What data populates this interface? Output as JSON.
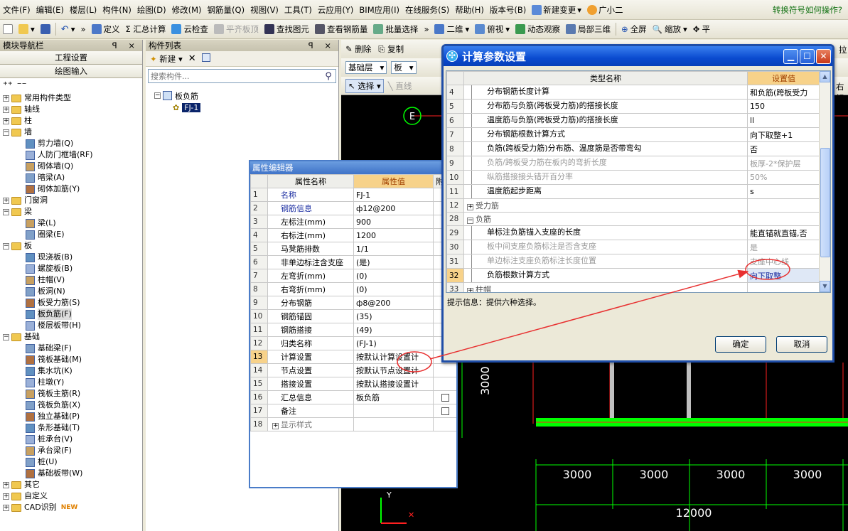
{
  "menubar": {
    "items": [
      "文件(F)",
      "编辑(E)",
      "楼层(L)",
      "构件(N)",
      "绘图(D)",
      "修改(M)",
      "钢筋量(Q)",
      "视图(V)",
      "工具(T)",
      "云应用(Y)",
      "BIM应用(I)",
      "在线服务(S)",
      "帮助(H)",
      "版本号(B)"
    ],
    "new_change": "新建变更",
    "guangxiaoer": "广小二",
    "help_link": "转换符号如何操作?"
  },
  "toolbar": {
    "define": "定义",
    "sum_calc": "Σ 汇总计算",
    "cloud_check": "云检查",
    "flush_slab": "平齐板顶",
    "find_element": "查找图元",
    "view_rebar": "查看钢筋量",
    "batch_select": "批量选择",
    "view_2d": "二维",
    "top_view": "俯视",
    "dynamic_view": "动态观察",
    "local_3d": "局部三维",
    "fullscreen": "全屏",
    "zoom": "缩放",
    "pan": "平"
  },
  "left_panel": {
    "title": "模块导航栏",
    "title_ctrl": "ꟼ ×",
    "project_settings": "工程设置",
    "drawing_input": "绘图输入",
    "tree": [
      {
        "label": "常用构件类型",
        "level": 0,
        "pm": "+"
      },
      {
        "label": "轴线",
        "level": 0,
        "pm": "+"
      },
      {
        "label": "柱",
        "level": 0,
        "pm": "+"
      },
      {
        "label": "墙",
        "level": 0,
        "pm": "−"
      },
      {
        "label": "剪力墙(Q)",
        "level": 1
      },
      {
        "label": "人防门框墙(RF)",
        "level": 1
      },
      {
        "label": "砌体墙(Q)",
        "level": 1
      },
      {
        "label": "暗梁(A)",
        "level": 1
      },
      {
        "label": "砌体加筋(Y)",
        "level": 1
      },
      {
        "label": "门窗洞",
        "level": 0,
        "pm": "+"
      },
      {
        "label": "梁",
        "level": 0,
        "pm": "−"
      },
      {
        "label": "梁(L)",
        "level": 1
      },
      {
        "label": "圈梁(E)",
        "level": 1
      },
      {
        "label": "板",
        "level": 0,
        "pm": "−"
      },
      {
        "label": "现浇板(B)",
        "level": 1
      },
      {
        "label": "螺旋板(B)",
        "level": 1
      },
      {
        "label": "柱帽(V)",
        "level": 1
      },
      {
        "label": "板洞(N)",
        "level": 1
      },
      {
        "label": "板受力筋(S)",
        "level": 1
      },
      {
        "label": "板负筋(F)",
        "level": 1,
        "selected": true
      },
      {
        "label": "楼层板带(H)",
        "level": 1
      },
      {
        "label": "基础",
        "level": 0,
        "pm": "−"
      },
      {
        "label": "基础梁(F)",
        "level": 1
      },
      {
        "label": "筏板基础(M)",
        "level": 1
      },
      {
        "label": "集水坑(K)",
        "level": 1
      },
      {
        "label": "柱墩(Y)",
        "level": 1
      },
      {
        "label": "筏板主筋(R)",
        "level": 1
      },
      {
        "label": "筏板负筋(X)",
        "level": 1
      },
      {
        "label": "独立基础(P)",
        "level": 1
      },
      {
        "label": "条形基础(T)",
        "level": 1
      },
      {
        "label": "桩承台(V)",
        "level": 1
      },
      {
        "label": "承台梁(F)",
        "level": 1
      },
      {
        "label": "桩(U)",
        "level": 1
      },
      {
        "label": "基础板带(W)",
        "level": 1
      },
      {
        "label": "其它",
        "level": 0,
        "pm": "+"
      },
      {
        "label": "自定义",
        "level": 0,
        "pm": "+"
      },
      {
        "label": "CAD识别",
        "level": 0,
        "pm": "+",
        "badge": "NEW"
      }
    ]
  },
  "comp_panel": {
    "title": "构件列表",
    "title_ctrl": "ꟼ ×",
    "new_label": "新建",
    "search_placeholder": "搜索构件...",
    "root": "板负筋",
    "child": "FJ-1"
  },
  "draw_toolbar": {
    "delete": "删除",
    "copy": "复制",
    "floor_combo": "基础层",
    "type_combo": "板",
    "select": "选择",
    "line": "直线",
    "axis_label": "E",
    "dim_vertical": "3000",
    "dims_bottom": [
      "3000",
      "3000",
      "3000",
      "3000"
    ],
    "dim_total": "12000",
    "axis_y": "Y",
    "right_clip_1": "拉",
    "right_clip_2": "右标"
  },
  "prop_editor": {
    "title": "属性编辑器",
    "col_name": "属性名称",
    "col_value": "属性值",
    "col_extra": "附",
    "rows": [
      {
        "n": "1",
        "name": "名称",
        "value": "FJ-1",
        "blue": true,
        "cb": false
      },
      {
        "n": "2",
        "name": "钢筋信息",
        "value": "ф12@200",
        "blue": true,
        "cb": true
      },
      {
        "n": "3",
        "name": "左标注(mm)",
        "value": "900",
        "cb": true
      },
      {
        "n": "4",
        "name": "右标注(mm)",
        "value": "1200",
        "cb": true
      },
      {
        "n": "5",
        "name": "马凳筋排数",
        "value": "1/1",
        "cb": true
      },
      {
        "n": "6",
        "name": "非单边标注含支座",
        "value": "(是)",
        "cb": true
      },
      {
        "n": "7",
        "name": "左弯折(mm)",
        "value": "(0)",
        "cb": true
      },
      {
        "n": "8",
        "name": "右弯折(mm)",
        "value": "(0)",
        "cb": true
      },
      {
        "n": "9",
        "name": "分布钢筋",
        "value": "ф8@200",
        "cb": true
      },
      {
        "n": "10",
        "name": "钢筋锚固",
        "value": "(35)",
        "cb": true
      },
      {
        "n": "11",
        "name": "钢筋搭接",
        "value": "(49)",
        "cb": true
      },
      {
        "n": "12",
        "name": "归类名称",
        "value": "(FJ-1)",
        "cb": true
      },
      {
        "n": "13",
        "name": "计算设置",
        "value": "按默认计算设置计",
        "selected": true
      },
      {
        "n": "14",
        "name": "节点设置",
        "value": "按默认节点设置计"
      },
      {
        "n": "15",
        "name": "搭接设置",
        "value": "按默认搭接设置计"
      },
      {
        "n": "16",
        "name": "汇总信息",
        "value": "板负筋",
        "cb": true
      },
      {
        "n": "17",
        "name": "备注",
        "value": "",
        "cb": true
      },
      {
        "n": "18",
        "name": "显示样式",
        "value": "",
        "group": true
      }
    ]
  },
  "calc_dialog": {
    "title": "计算参数设置",
    "col_type": "类型名称",
    "col_value": "设置值",
    "rows": [
      {
        "n": "4",
        "name": "分布钢筋长度计算",
        "value": "和负筋(跨板受力",
        "indent": true
      },
      {
        "n": "5",
        "name": "分布筋与负筋(跨板受力筋)的搭接长度",
        "value": "150",
        "indent": true
      },
      {
        "n": "6",
        "name": "温度筋与负筋(跨板受力筋)的搭接长度",
        "value": "ll",
        "indent": true
      },
      {
        "n": "7",
        "name": "分布钢筋根数计算方式",
        "value": "向下取整+1",
        "indent": true
      },
      {
        "n": "8",
        "name": "负筋(跨板受力筋)分布筋、温度筋是否带弯勾",
        "value": "否",
        "indent": true
      },
      {
        "n": "9",
        "name": "负筋/跨板受力筋在板内的弯折长度",
        "value": "板厚-2*保护层",
        "indent": true,
        "disabled": true
      },
      {
        "n": "10",
        "name": "纵筋搭接接头错开百分率",
        "value": "50%",
        "indent": true,
        "disabled": true
      },
      {
        "n": "11",
        "name": "温度筋起步距离",
        "value": "s",
        "indent": true
      },
      {
        "n": "12",
        "name": "受力筋",
        "value": "",
        "group": true,
        "pm": "+"
      },
      {
        "n": "28",
        "name": "负筋",
        "value": "",
        "group": true,
        "pm": "−"
      },
      {
        "n": "29",
        "name": "单标注负筋锚入支座的长度",
        "value": "能直锚就直锚,否",
        "indent": true
      },
      {
        "n": "30",
        "name": "板中间支座负筋标注是否含支座",
        "value": "是",
        "indent": true,
        "disabled": true
      },
      {
        "n": "31",
        "name": "单边标注支座负筋标注长度位置",
        "value": "支座中心线",
        "indent": true,
        "disabled": true
      },
      {
        "n": "32",
        "name": "负筋根数计算方式",
        "value": "向下取整",
        "indent": true,
        "selected": true
      },
      {
        "n": "33",
        "name": "柱帽",
        "value": "",
        "group": true,
        "pm": "+"
      }
    ],
    "info_text": "提示信息：提供六种选择。",
    "ok": "确定",
    "cancel": "取消"
  },
  "colors": {
    "title_blue": "#0a4bd0",
    "highlight_header": "#f7d28a",
    "canvas_green": "#00ff00",
    "canvas_red": "#ff2020",
    "arrow_red": "#e83030"
  }
}
